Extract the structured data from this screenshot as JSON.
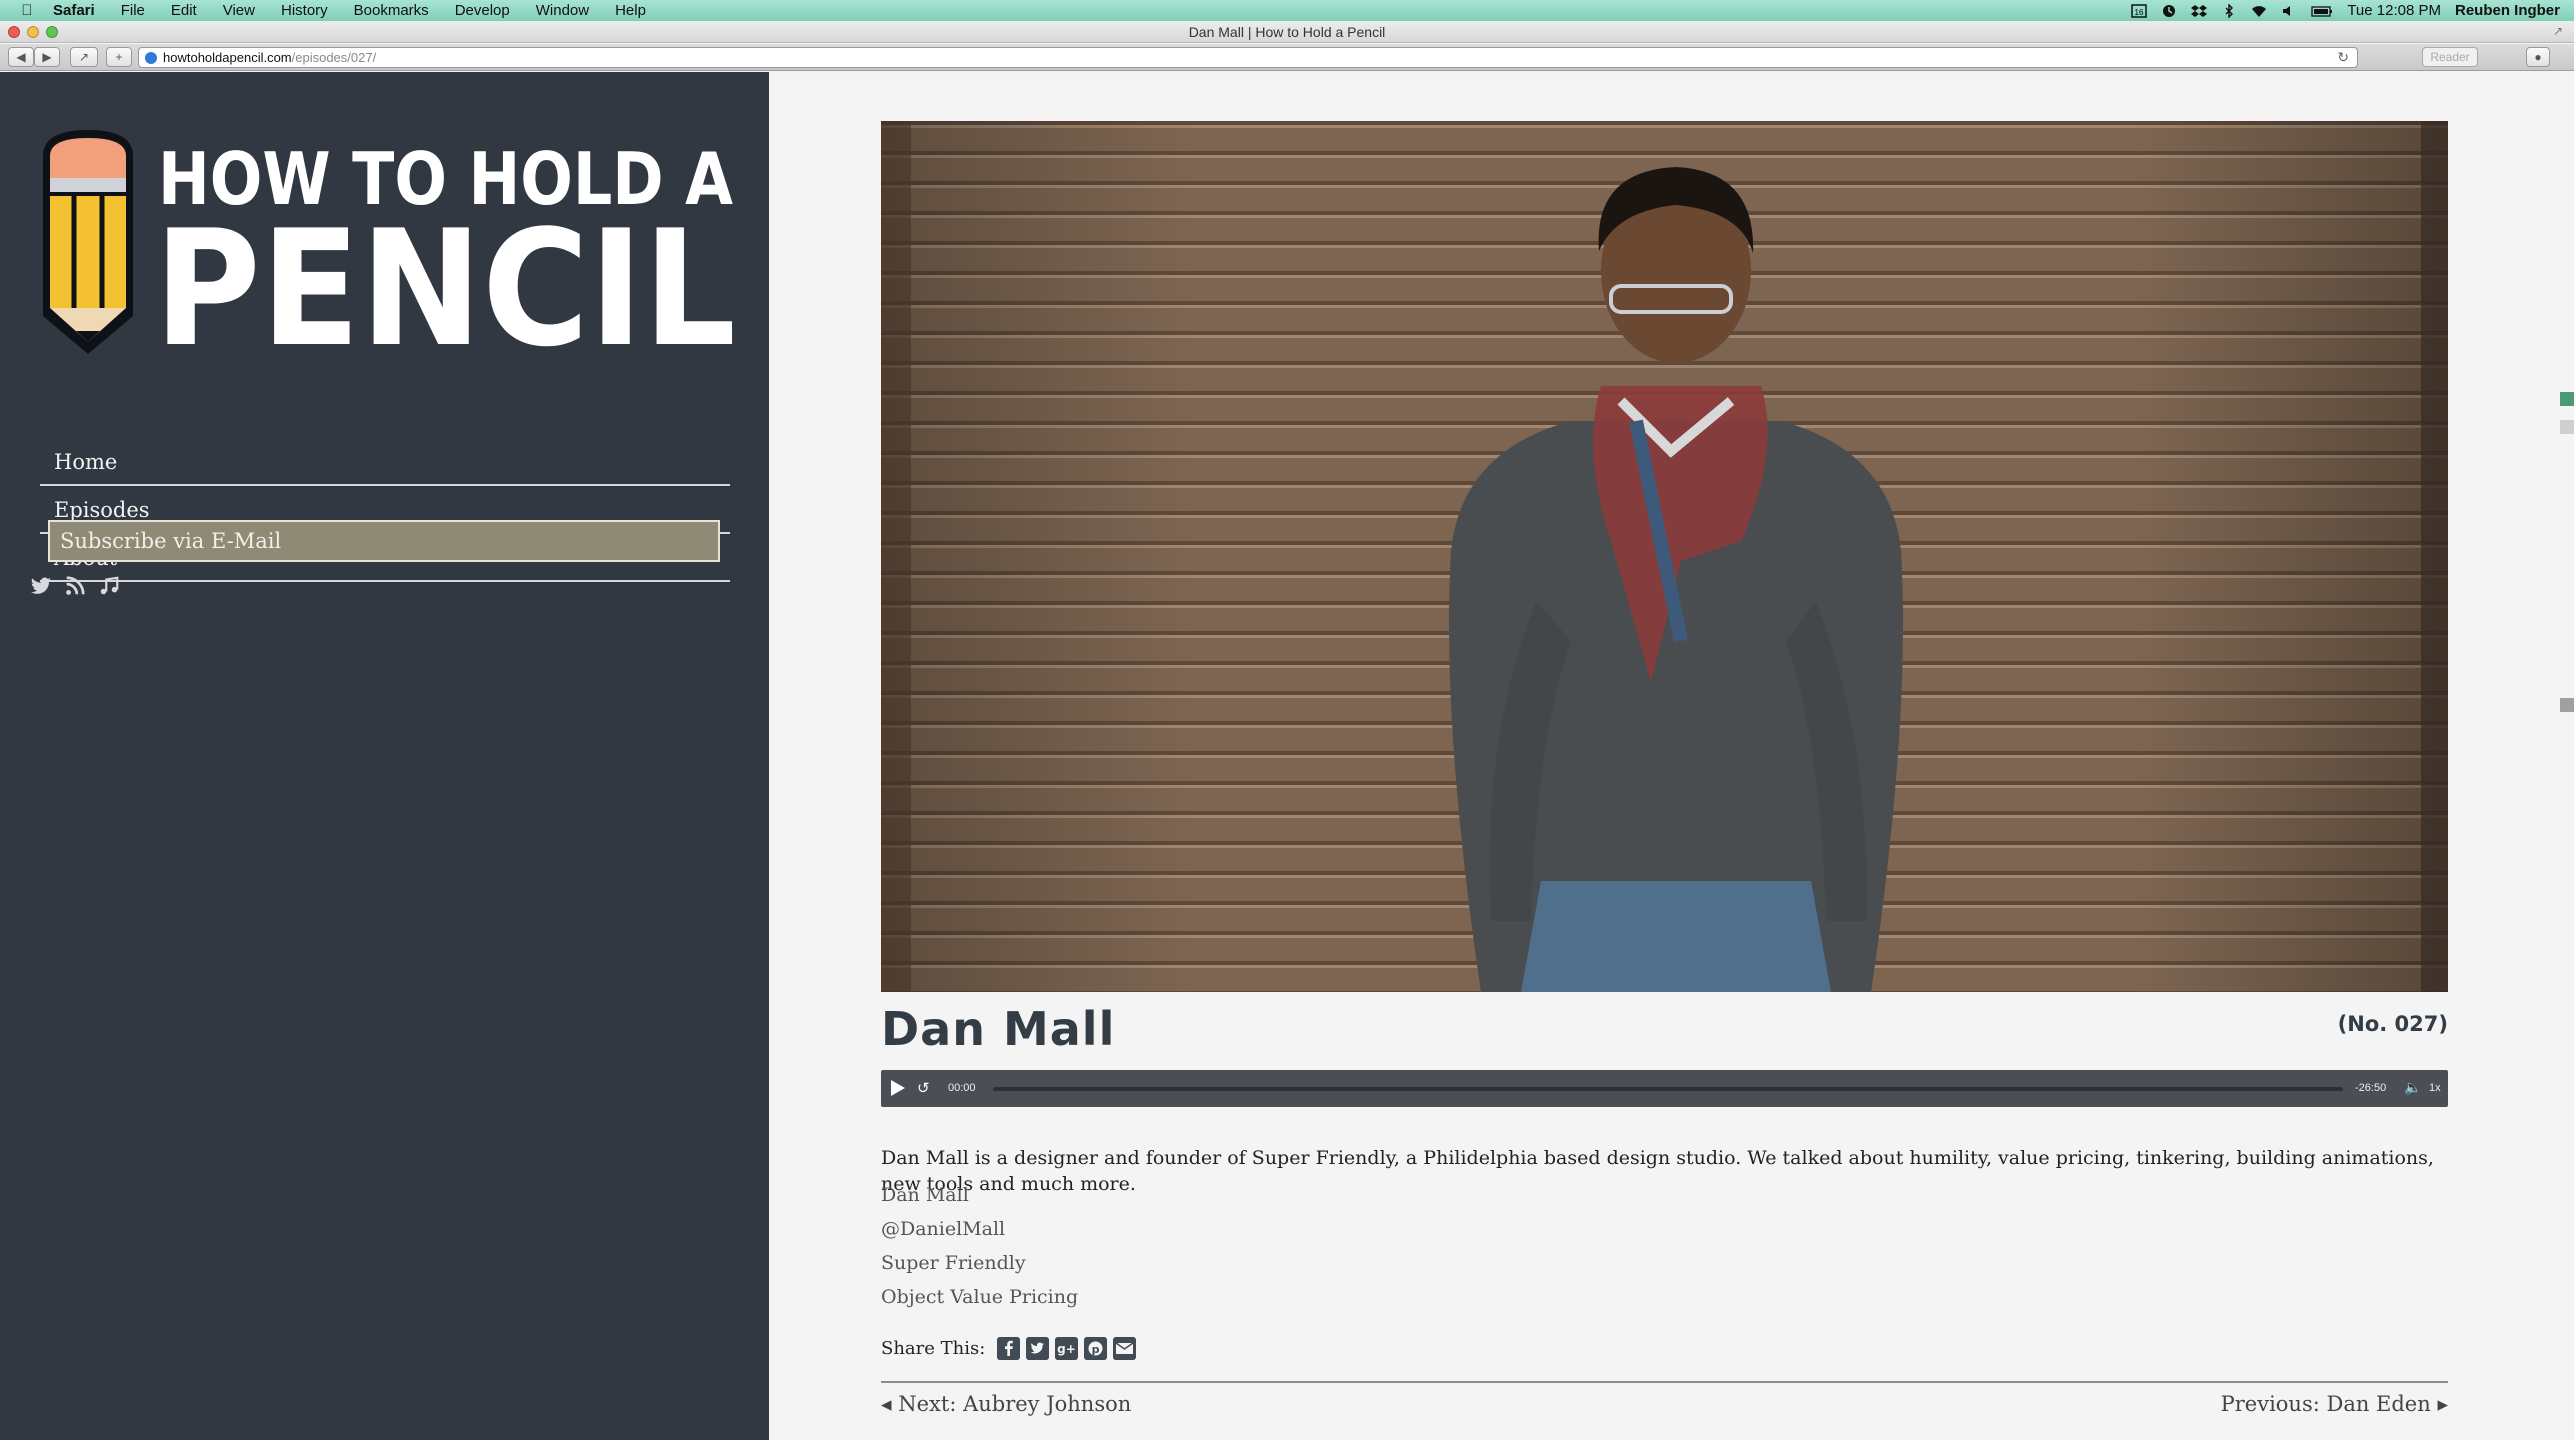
{
  "menubar": {
    "items": [
      "Safari",
      "File",
      "Edit",
      "View",
      "History",
      "Bookmarks",
      "Develop",
      "Window",
      "Help"
    ],
    "clock": "Tue 12:08 PM",
    "user": "Reuben Ingber"
  },
  "window": {
    "title": "Dan Mall | How to Hold a Pencil",
    "url_host": "howtoholdapencil.com",
    "url_path": "/episodes/027/",
    "reader_label": "Reader"
  },
  "site": {
    "logo_line1": "HOW TO HOLD A",
    "logo_line2": "PENCIL",
    "nav": [
      "Home",
      "Episodes",
      "About"
    ],
    "subscribe_label": "Subscribe via E-Mail",
    "social_icons": [
      "twitter-icon",
      "rss-icon",
      "music-note-icon"
    ]
  },
  "episode": {
    "guest_name": "Dan Mall",
    "number": "(No. 027)",
    "player": {
      "current_time": "00:00",
      "remaining_time": "-26:50",
      "speed": "1x",
      "progress": 0
    },
    "description": "Dan Mall is a designer and founder of Super Friendly, a Philidelphia based design studio. We talked about humility, value pricing, tinkering, building animations, new tools and much more.",
    "links": [
      "Dan Mall",
      "@DanielMall",
      "Super Friendly",
      "Object Value Pricing"
    ],
    "share_label": "Share This:",
    "share_icons": [
      "facebook-icon",
      "twitter-icon",
      "google-plus-icon",
      "pinterest-icon",
      "email-icon"
    ],
    "next_label": "Next: Aubrey Johnson",
    "prev_label": "Previous: Dan Eden"
  },
  "colors": {
    "sidebar_bg": "#323841",
    "content_bg": "#f4f4f4",
    "subscribe_bg": "#8f8a76",
    "title_color": "#343c46",
    "player_bg": "#4b4f55",
    "pencil_yellow": "#f4c133",
    "pencil_orange": "#f2a07b"
  }
}
